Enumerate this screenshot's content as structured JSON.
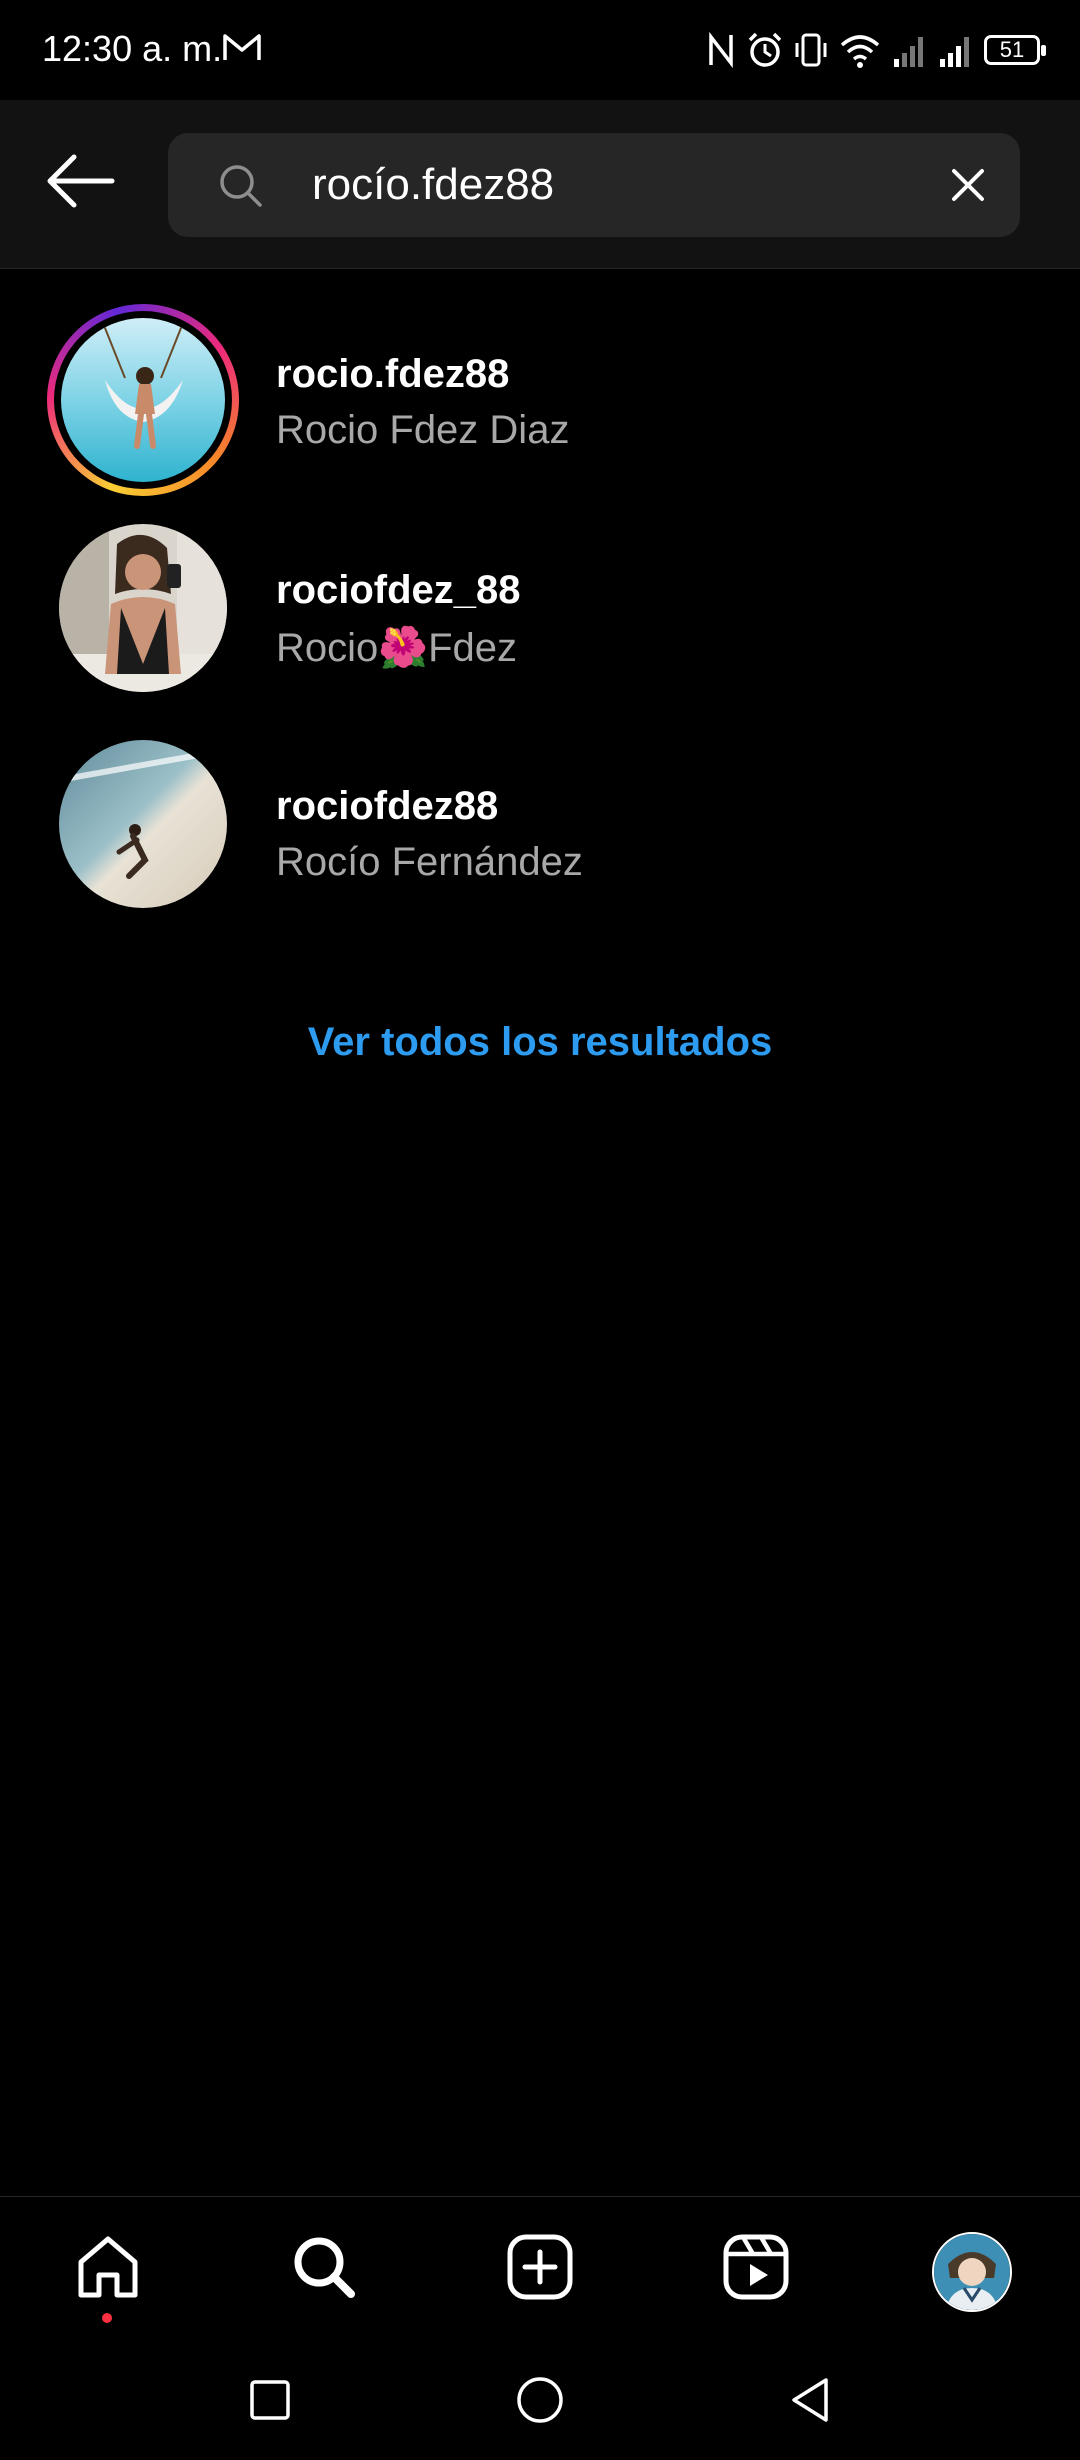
{
  "status_bar": {
    "time": "12:30 a. m.",
    "battery": "51",
    "icons": [
      "gmail-icon",
      "nfc-icon",
      "alarm-icon",
      "vibrate-icon",
      "wifi-icon",
      "signal-icon",
      "signal-icon",
      "battery-icon"
    ]
  },
  "search": {
    "query": "rocío.fdez88",
    "back_icon": "arrow-left-icon",
    "search_icon": "search-icon",
    "clear_icon": "close-icon"
  },
  "results": [
    {
      "username": "rocio.fdez88",
      "fullname": "Rocio Fdez Diaz",
      "has_story": true
    },
    {
      "username": "rociofdez_88",
      "fullname": "Rocio🌺Fdez",
      "has_story": false
    },
    {
      "username": "rociofdez88",
      "fullname": "Rocío Fernández",
      "has_story": false
    }
  ],
  "see_all": "Ver todos los resultados",
  "bottom_nav": {
    "items": [
      "home-icon",
      "search-icon",
      "create-icon",
      "reels-icon",
      "profile-avatar"
    ],
    "active": "search-icon",
    "notification_dot_color": "#ff3040"
  },
  "system_nav": [
    "recents-square-icon",
    "home-circle-icon",
    "back-triangle-icon"
  ],
  "colors": {
    "background": "#000000",
    "header": "#121212",
    "search_box": "#262626",
    "link": "#2d9cf0",
    "secondary_text": "#a8a8a8"
  }
}
